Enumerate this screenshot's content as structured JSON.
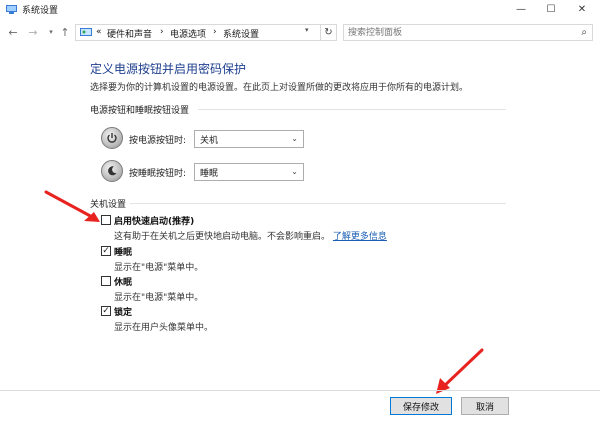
{
  "window": {
    "title": "系统设置",
    "minimize_glyph": "—",
    "maximize_glyph": "☐",
    "close_glyph": "✕"
  },
  "address_bar": {
    "overflow": "«",
    "crumbs": [
      "硬件和声音",
      "电源选项",
      "系统设置"
    ],
    "separator": "›",
    "search_placeholder": "搜索控制面板"
  },
  "page": {
    "heading": "定义电源按钮并启用密码保护",
    "subheading": "选择要为你的计算机设置的电源设置。在此页上对设置所做的更改将应用于你所有的电源计划。"
  },
  "power_section": {
    "label": "电源按钮和睡眠按钮设置",
    "power_button": {
      "label": "按电源按钮时:",
      "value": "关机"
    },
    "sleep_button": {
      "label": "按睡眠按钮时:",
      "value": "睡眠"
    }
  },
  "shutdown_section": {
    "label": "关机设置",
    "items": [
      {
        "label": "启用快速启动(推荐)",
        "checked": false,
        "desc": "这有助于在关机之后更快地启动电脑。不会影响重启。",
        "link": "了解更多信息"
      },
      {
        "label": "睡眠",
        "checked": true,
        "desc": "显示在\"电源\"菜单中。"
      },
      {
        "label": "休眠",
        "checked": false,
        "desc": "显示在\"电源\"菜单中。"
      },
      {
        "label": "锁定",
        "checked": true,
        "desc": "显示在用户头像菜单中。"
      }
    ]
  },
  "buttons": {
    "save": "保存修改",
    "cancel": "取消"
  },
  "colors": {
    "heading": "#1e3f8f",
    "link": "#1a5fb4",
    "annotation_arrow": "#e8231f",
    "save_border": "#0078d7"
  }
}
